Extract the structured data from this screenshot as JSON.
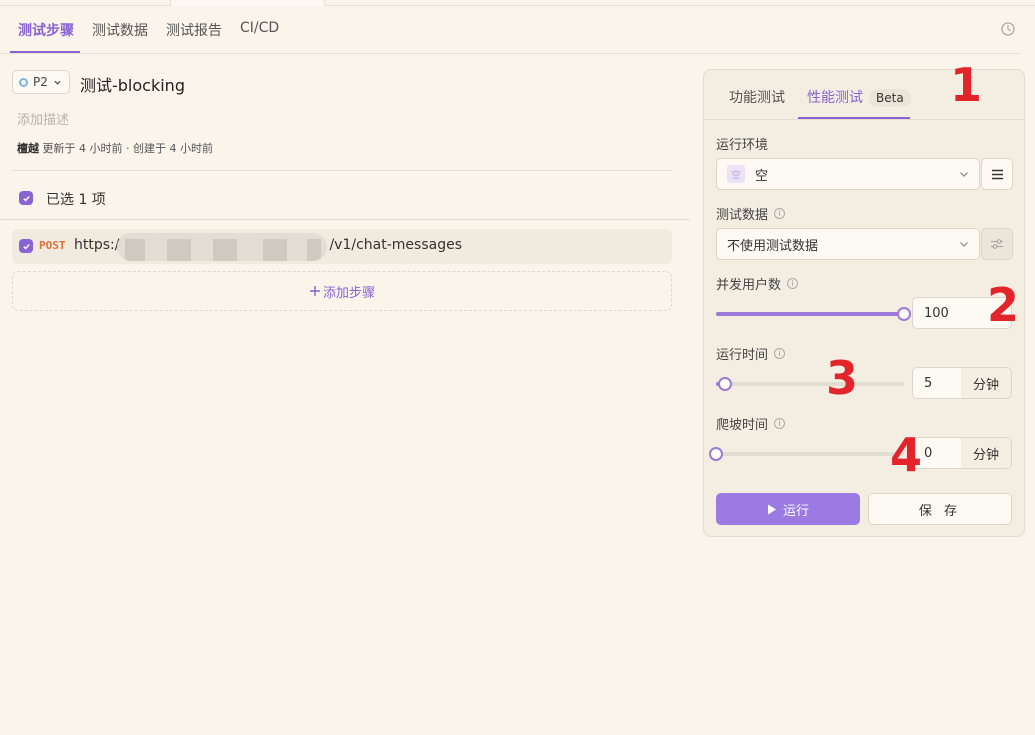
{
  "tabs": [
    {
      "label": "测试步骤"
    },
    {
      "label": "测试数据"
    },
    {
      "label": "测试报告"
    },
    {
      "label": "CI/CD"
    }
  ],
  "case": {
    "priority": "P2",
    "title": "测试-blocking",
    "description_placeholder": "添加描述",
    "author": "檀越",
    "meta": "更新于 4 小时前 · 创建于 4 小时前"
  },
  "selection": {
    "label": "已选 1 项"
  },
  "steps": [
    {
      "method": "POST",
      "url_prefix": "https:/",
      "url_suffix": "/v1/chat-messages"
    }
  ],
  "add_step_label": "添加步骤",
  "panel": {
    "tabs": [
      {
        "label": "功能测试"
      },
      {
        "label": "性能测试",
        "badge": "Beta"
      }
    ],
    "env": {
      "label": "运行环境",
      "badge": "空",
      "value": "空"
    },
    "test_data": {
      "label": "测试数据",
      "value": "不使用测试数据"
    },
    "concurrency": {
      "label": "并发用户数",
      "value": "100",
      "level": 1.0
    },
    "duration": {
      "label": "运行时间",
      "value": "5",
      "unit": "分钟",
      "level": 0.05
    },
    "rampup": {
      "label": "爬坡时间",
      "value": "0",
      "unit": "分钟",
      "level": 0.0
    },
    "run_label": "运行",
    "save_label": "保 存"
  },
  "markers": [
    "1",
    "2",
    "3",
    "4"
  ],
  "colors": {
    "accent": "#8a63d2",
    "marker": "#e3242b",
    "method_post": "#e0703a",
    "background": "#faf4ea"
  }
}
